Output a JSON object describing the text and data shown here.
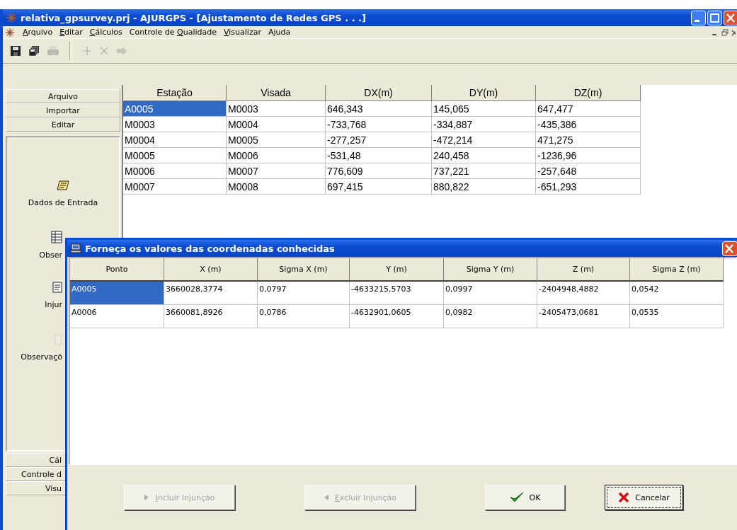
{
  "window": {
    "title": "relativa_gpsurvey.prj - AJURGPS - [Ajustamento de Redes GPS . . .]"
  },
  "menu": [
    {
      "label_parts": {
        "key": "A",
        "post": "rquivo"
      }
    },
    {
      "label_parts": {
        "key": "E",
        "post": "ditar"
      }
    },
    {
      "label_parts": {
        "key": "C",
        "post": "álculos"
      }
    },
    {
      "label_parts": {
        "pre": "Controle de ",
        "key": "Q",
        "post": "ualidade"
      }
    },
    {
      "label_parts": {
        "key": "V",
        "post": "isualizar"
      }
    },
    {
      "label_parts": {
        "pre": "Ajuda"
      }
    }
  ],
  "toolbar": [
    {
      "kind": "save",
      "disabled": false
    },
    {
      "kind": "save-all",
      "disabled": false
    },
    {
      "kind": "print",
      "disabled": true
    },
    {
      "kind": "separator"
    },
    {
      "kind": "add",
      "disabled": true
    },
    {
      "kind": "delete",
      "disabled": true
    },
    {
      "kind": "move",
      "disabled": true
    }
  ],
  "sidebar": {
    "top_buttons": [
      {
        "label": "Arquivo"
      },
      {
        "label": "Importar"
      },
      {
        "label": "Editar"
      }
    ],
    "items": [
      {
        "label": "Dados de Entrada",
        "kind": "notes",
        "clipped": false,
        "disabled": false
      },
      {
        "label": "Obser",
        "kind": "table",
        "clipped": true,
        "disabled": false
      },
      {
        "label": "Injur",
        "kind": "form",
        "clipped": true,
        "disabled": false
      },
      {
        "label": "Observaçõ",
        "kind": "trash",
        "clipped": true,
        "disabled": true
      }
    ],
    "bottom_buttons": [
      {
        "label": "Cál",
        "clipped": true
      },
      {
        "label": "Controle d",
        "clipped": true
      },
      {
        "label": "Visu",
        "clipped": true
      }
    ]
  },
  "table": {
    "columns": [
      "Estação",
      "Visada",
      "DX(m)",
      "DY(m)",
      "DZ(m)"
    ],
    "rows": [
      {
        "cells": [
          "A0005",
          "M0003",
          "646,343",
          "145,065",
          "647,477"
        ],
        "selected": true
      },
      {
        "cells": [
          "M0003",
          "M0004",
          "-733,768",
          "-334,887",
          "-435,386"
        ],
        "selected": false
      },
      {
        "cells": [
          "M0004",
          "M0005",
          "-277,257",
          "-472,214",
          "471,275"
        ],
        "selected": false
      },
      {
        "cells": [
          "M0005",
          "M0006",
          "-531,48",
          "240,458",
          "-1236,96"
        ],
        "selected": false
      },
      {
        "cells": [
          "M0006",
          "M0007",
          "776,609",
          "737,221",
          "-257,648"
        ],
        "selected": false
      },
      {
        "cells": [
          "M0007",
          "M0008",
          "697,415",
          "880,822",
          "-651,293"
        ],
        "selected": false
      }
    ]
  },
  "dialog": {
    "title": "Forneça os valores das coordenadas conhecidas",
    "table": {
      "columns": [
        "Ponto",
        "X (m)",
        "Sigma X (m)",
        "Y (m)",
        "Sigma Y (m)",
        "Z (m)",
        "Sigma Z (m)"
      ],
      "rows": [
        {
          "cells": [
            "A0005",
            "3660028,3774",
            "0,0797",
            "-4633215,5703",
            "0,0997",
            "-2404948,4882",
            "0,0542"
          ],
          "selected": true
        },
        {
          "cells": [
            "A0006",
            "3660081,8926",
            "0,0786",
            "-4632901,0605",
            "0,0982",
            "-2405473,0681",
            "0,0535"
          ],
          "selected": false
        }
      ]
    },
    "buttons": [
      {
        "label_parts": {
          "key": "I",
          "post": "ncluir Injunção"
        },
        "kind": "include",
        "disabled": true,
        "default": false
      },
      {
        "label_parts": {
          "key": "E",
          "post": "xcluir Injunção"
        },
        "kind": "exclude",
        "disabled": true,
        "default": false
      },
      {
        "label_parts": {
          "pre": "OK"
        },
        "kind": "ok",
        "disabled": false,
        "default": false
      },
      {
        "label_parts": {
          "pre": "Cancelar"
        },
        "kind": "cancel",
        "disabled": false,
        "default": true
      }
    ]
  }
}
